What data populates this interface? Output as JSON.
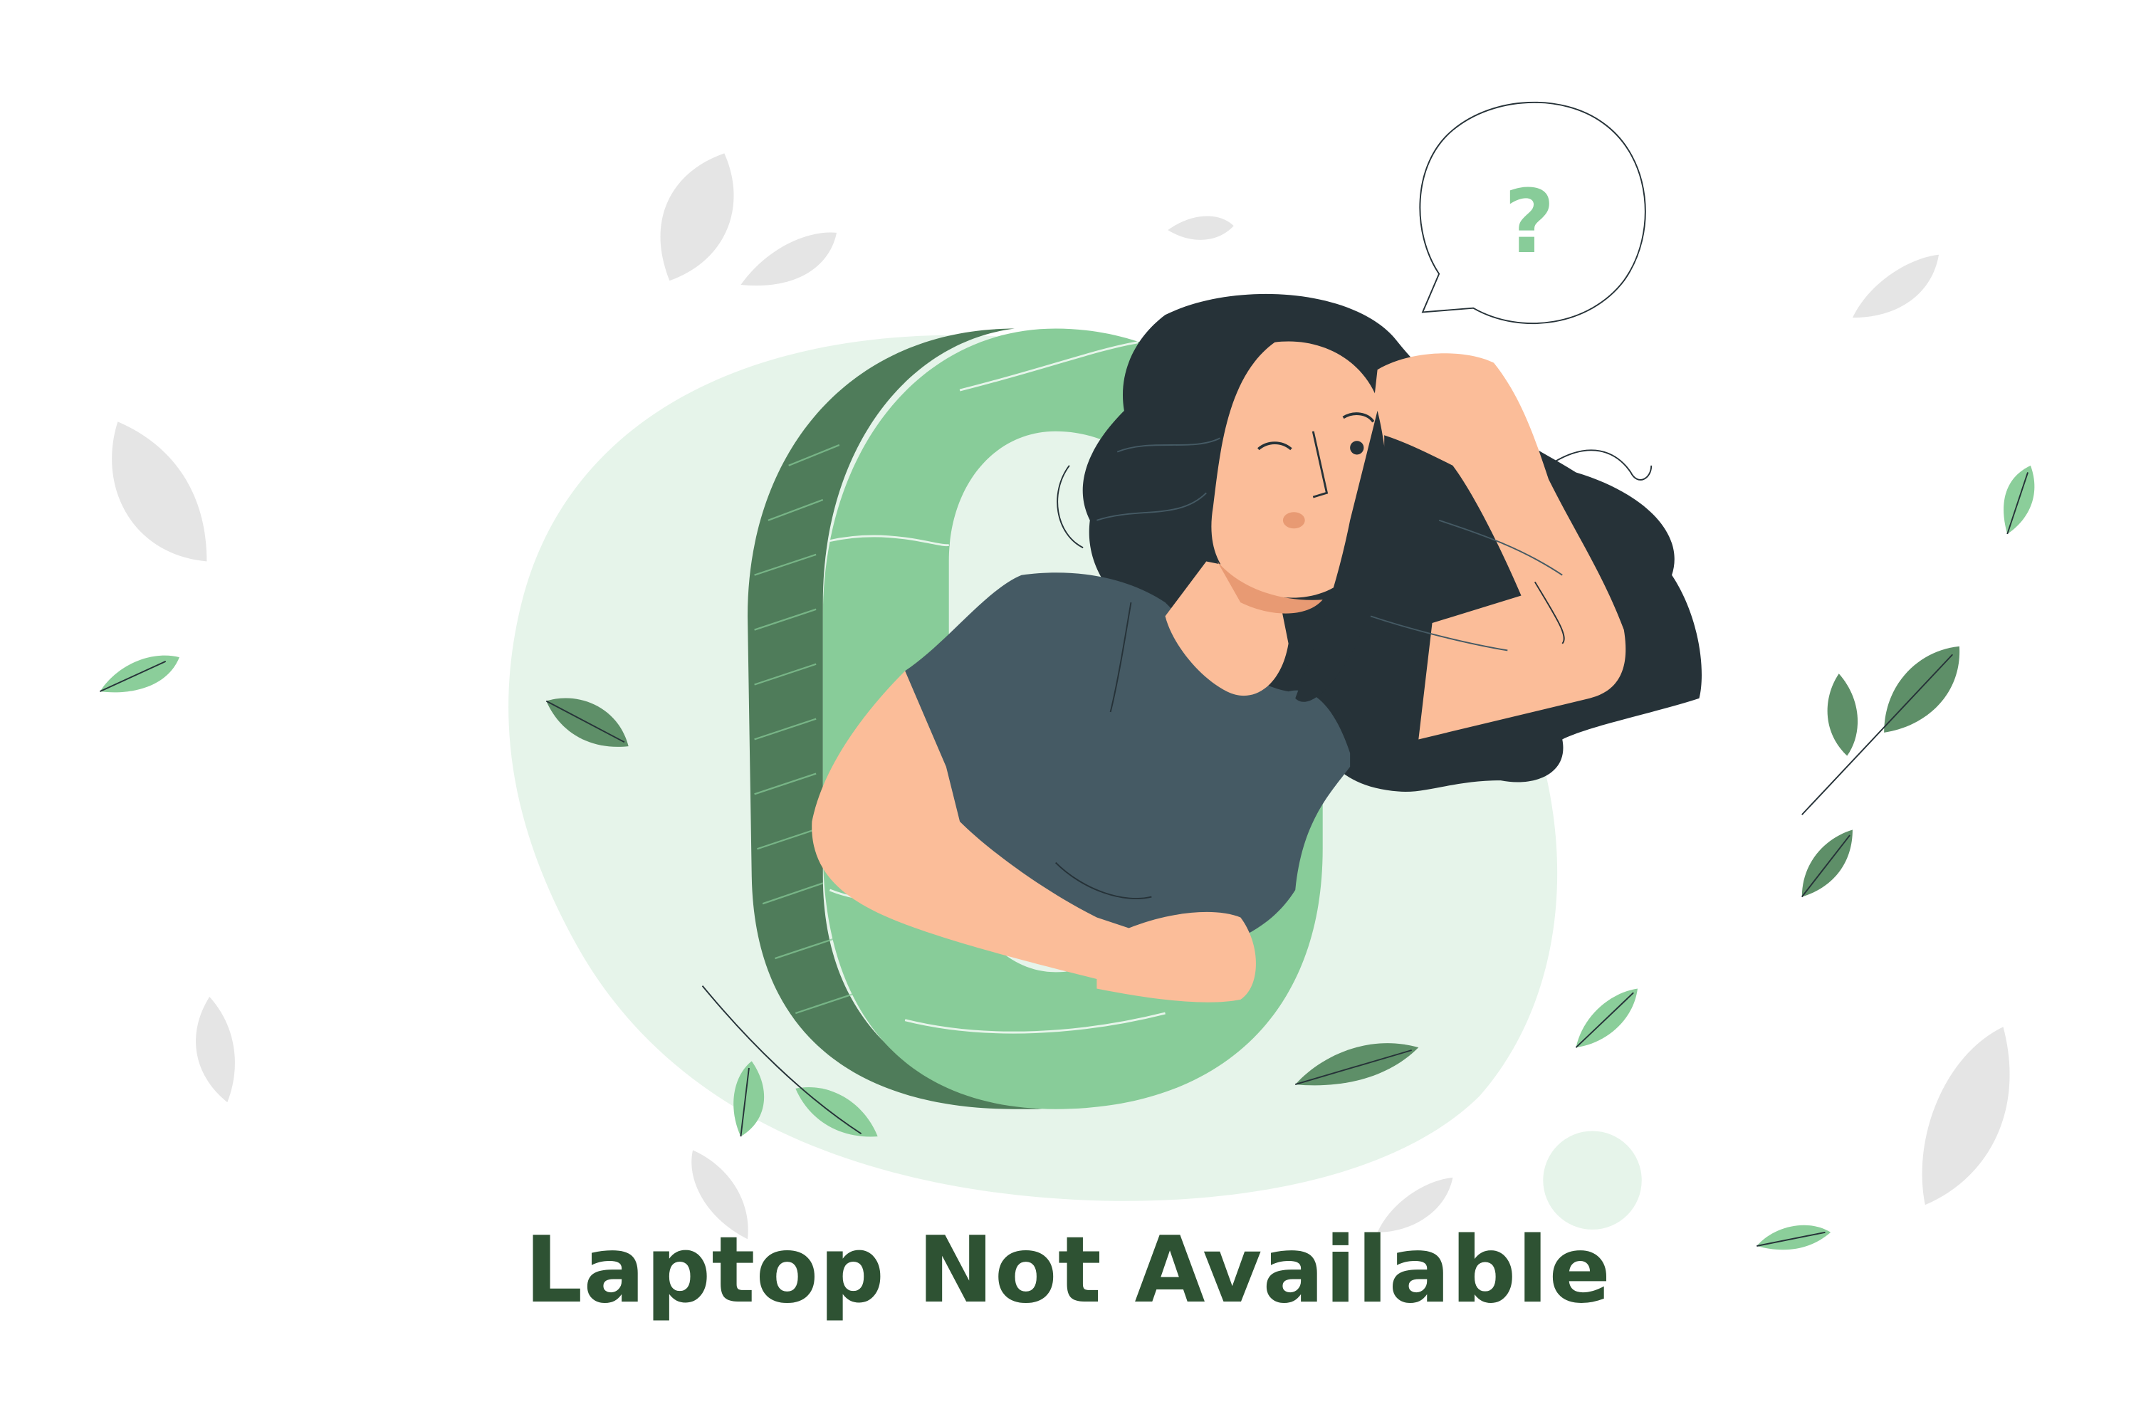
{
  "message": {
    "text": "Laptop Not Available"
  },
  "speech_bubble": {
    "symbol": "?"
  },
  "colors": {
    "heading": "#2e5233",
    "accent_green": "#88cc99",
    "dark_green": "#4f7c5a",
    "leaf_green": "#5e8f68",
    "leaf_light": "#8bce9a",
    "blob_background": "#e6f4ea",
    "leaf_grey": "#e5e5e5",
    "hair": "#263238",
    "shirt": "#455a64",
    "skin": "#fbbd99",
    "skin_shadow": "#e89a73",
    "outline": "#263238"
  },
  "icons": {
    "bubble": "speech-bubble-icon",
    "question": "question-mark-icon",
    "leaf": "leaf-icon"
  }
}
